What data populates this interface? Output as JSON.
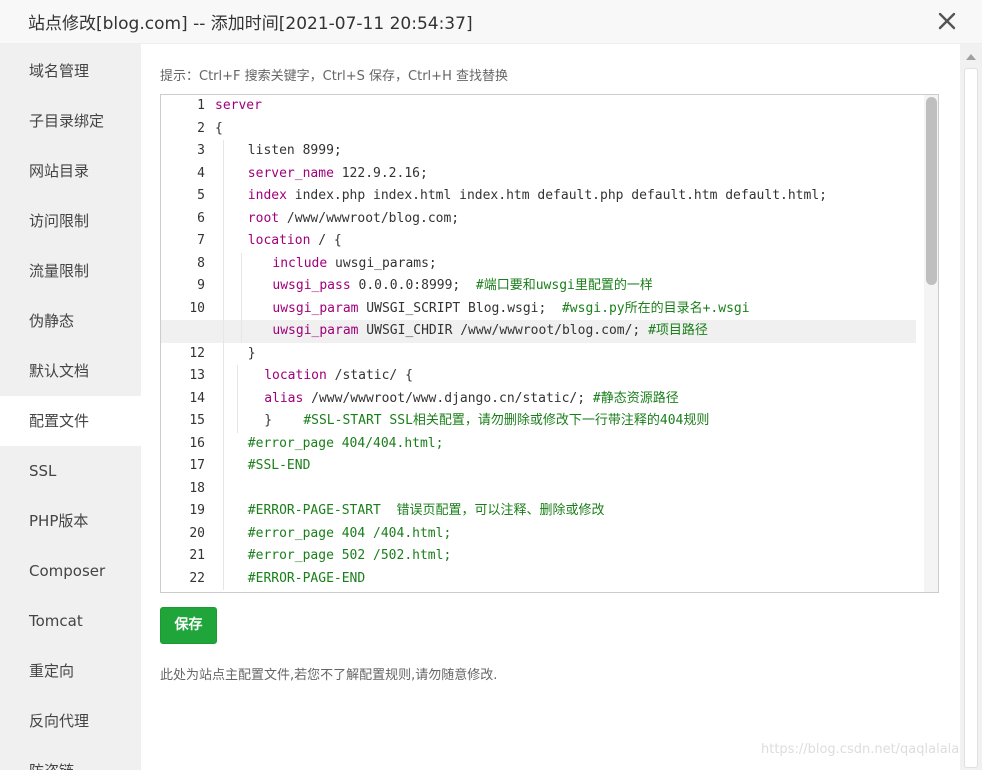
{
  "window": {
    "title": "站点修改[blog.com] -- 添加时间[2021-07-11 20:54:37]",
    "close_icon": "close-icon"
  },
  "sidebar": {
    "active_index": 7,
    "items": [
      {
        "label": "域名管理"
      },
      {
        "label": "子目录绑定"
      },
      {
        "label": "网站目录"
      },
      {
        "label": "访问限制"
      },
      {
        "label": "流量限制"
      },
      {
        "label": "伪静态"
      },
      {
        "label": "默认文档"
      },
      {
        "label": "配置文件"
      },
      {
        "label": "SSL"
      },
      {
        "label": "PHP版本"
      },
      {
        "label": "Composer"
      },
      {
        "label": "Tomcat"
      },
      {
        "label": "重定向"
      },
      {
        "label": "反向代理"
      },
      {
        "label": "防盗链"
      }
    ]
  },
  "editor": {
    "hint": "提示：Ctrl+F 搜索关键字，Ctrl+S 保存，Ctrl+H 查找替换",
    "current_line": 11,
    "lines": [
      {
        "no": "1",
        "indent": 0,
        "parts": [
          {
            "t": "server",
            "c": "kw"
          }
        ]
      },
      {
        "no": "2",
        "indent": 0,
        "parts": [
          {
            "t": "{",
            "c": ""
          }
        ]
      },
      {
        "no": "3",
        "indent": 4,
        "parts": [
          {
            "t": "listen 8999;",
            "c": ""
          }
        ]
      },
      {
        "no": "4",
        "indent": 4,
        "parts": [
          {
            "t": "server_name",
            "c": "kw"
          },
          {
            "t": " 122.9.2.16;",
            "c": ""
          }
        ]
      },
      {
        "no": "5",
        "indent": 4,
        "parts": [
          {
            "t": "index",
            "c": "kw"
          },
          {
            "t": " index.php index.html index.htm default.php default.htm default.html;",
            "c": ""
          }
        ]
      },
      {
        "no": "6",
        "indent": 4,
        "parts": [
          {
            "t": "root",
            "c": "kw"
          },
          {
            "t": " /www/wwwroot/blog.com;",
            "c": ""
          }
        ]
      },
      {
        "no": "7",
        "indent": 4,
        "parts": [
          {
            "t": "location",
            "c": "kw"
          },
          {
            "t": " / {",
            "c": ""
          }
        ]
      },
      {
        "no": "8",
        "indent": 7,
        "parts": [
          {
            "t": "include",
            "c": "kw"
          },
          {
            "t": " uwsgi_params;",
            "c": ""
          }
        ]
      },
      {
        "no": "9",
        "indent": 7,
        "parts": [
          {
            "t": "uwsgi_pass",
            "c": "kw"
          },
          {
            "t": " 0.0.0.0:8999;  ",
            "c": ""
          },
          {
            "t": "#端口要和uwsgi里配置的一样",
            "c": "cm"
          }
        ]
      },
      {
        "no": "10",
        "indent": 7,
        "parts": [
          {
            "t": "uwsgi_param",
            "c": "kw"
          },
          {
            "t": " UWSGI_SCRIPT Blog.wsgi;  ",
            "c": ""
          },
          {
            "t": "#wsgi.py所在的目录名+.wsgi",
            "c": "cm"
          }
        ]
      },
      {
        "no": "11",
        "indent": 7,
        "parts": [
          {
            "t": "uwsgi_param",
            "c": "kw"
          },
          {
            "t": " UWSGI_CHDIR /www/wwwroot/blog.com/; ",
            "c": ""
          },
          {
            "t": "#项目路径",
            "c": "cm"
          }
        ]
      },
      {
        "no": "12",
        "indent": 4,
        "parts": [
          {
            "t": "}",
            "c": ""
          }
        ]
      },
      {
        "no": "13",
        "indent": 6,
        "parts": [
          {
            "t": "location",
            "c": "kw"
          },
          {
            "t": " /static/ {",
            "c": ""
          }
        ]
      },
      {
        "no": "14",
        "indent": 6,
        "parts": [
          {
            "t": "alias",
            "c": "kw"
          },
          {
            "t": " /www/wwwroot/www.django.cn/static/; ",
            "c": ""
          },
          {
            "t": "#静态资源路径",
            "c": "cm"
          }
        ]
      },
      {
        "no": "15",
        "indent": 6,
        "parts": [
          {
            "t": "}    ",
            "c": ""
          },
          {
            "t": "#SSL-START SSL相关配置，请勿删除或修改下一行带注释的404规则",
            "c": "cm"
          }
        ]
      },
      {
        "no": "16",
        "indent": 4,
        "parts": [
          {
            "t": "#error_page 404/404.html;",
            "c": "cm"
          }
        ]
      },
      {
        "no": "17",
        "indent": 4,
        "parts": [
          {
            "t": "#SSL-END",
            "c": "cm"
          }
        ]
      },
      {
        "no": "18",
        "indent": 4,
        "parts": []
      },
      {
        "no": "19",
        "indent": 4,
        "parts": [
          {
            "t": "#ERROR-PAGE-START  错误页配置，可以注释、删除或修改",
            "c": "cm"
          }
        ]
      },
      {
        "no": "20",
        "indent": 4,
        "parts": [
          {
            "t": "#error_page 404 /404.html;",
            "c": "cm"
          }
        ]
      },
      {
        "no": "21",
        "indent": 4,
        "parts": [
          {
            "t": "#error_page 502 /502.html;",
            "c": "cm"
          }
        ]
      },
      {
        "no": "22",
        "indent": 4,
        "parts": [
          {
            "t": "#ERROR-PAGE-END",
            "c": "cm"
          }
        ]
      }
    ]
  },
  "save_button": {
    "label": "保存"
  },
  "note": "此处为站点主配置文件,若您不了解配置规则,请勿随意修改.",
  "watermark": "https://blog.csdn.net/qaqlalala"
}
